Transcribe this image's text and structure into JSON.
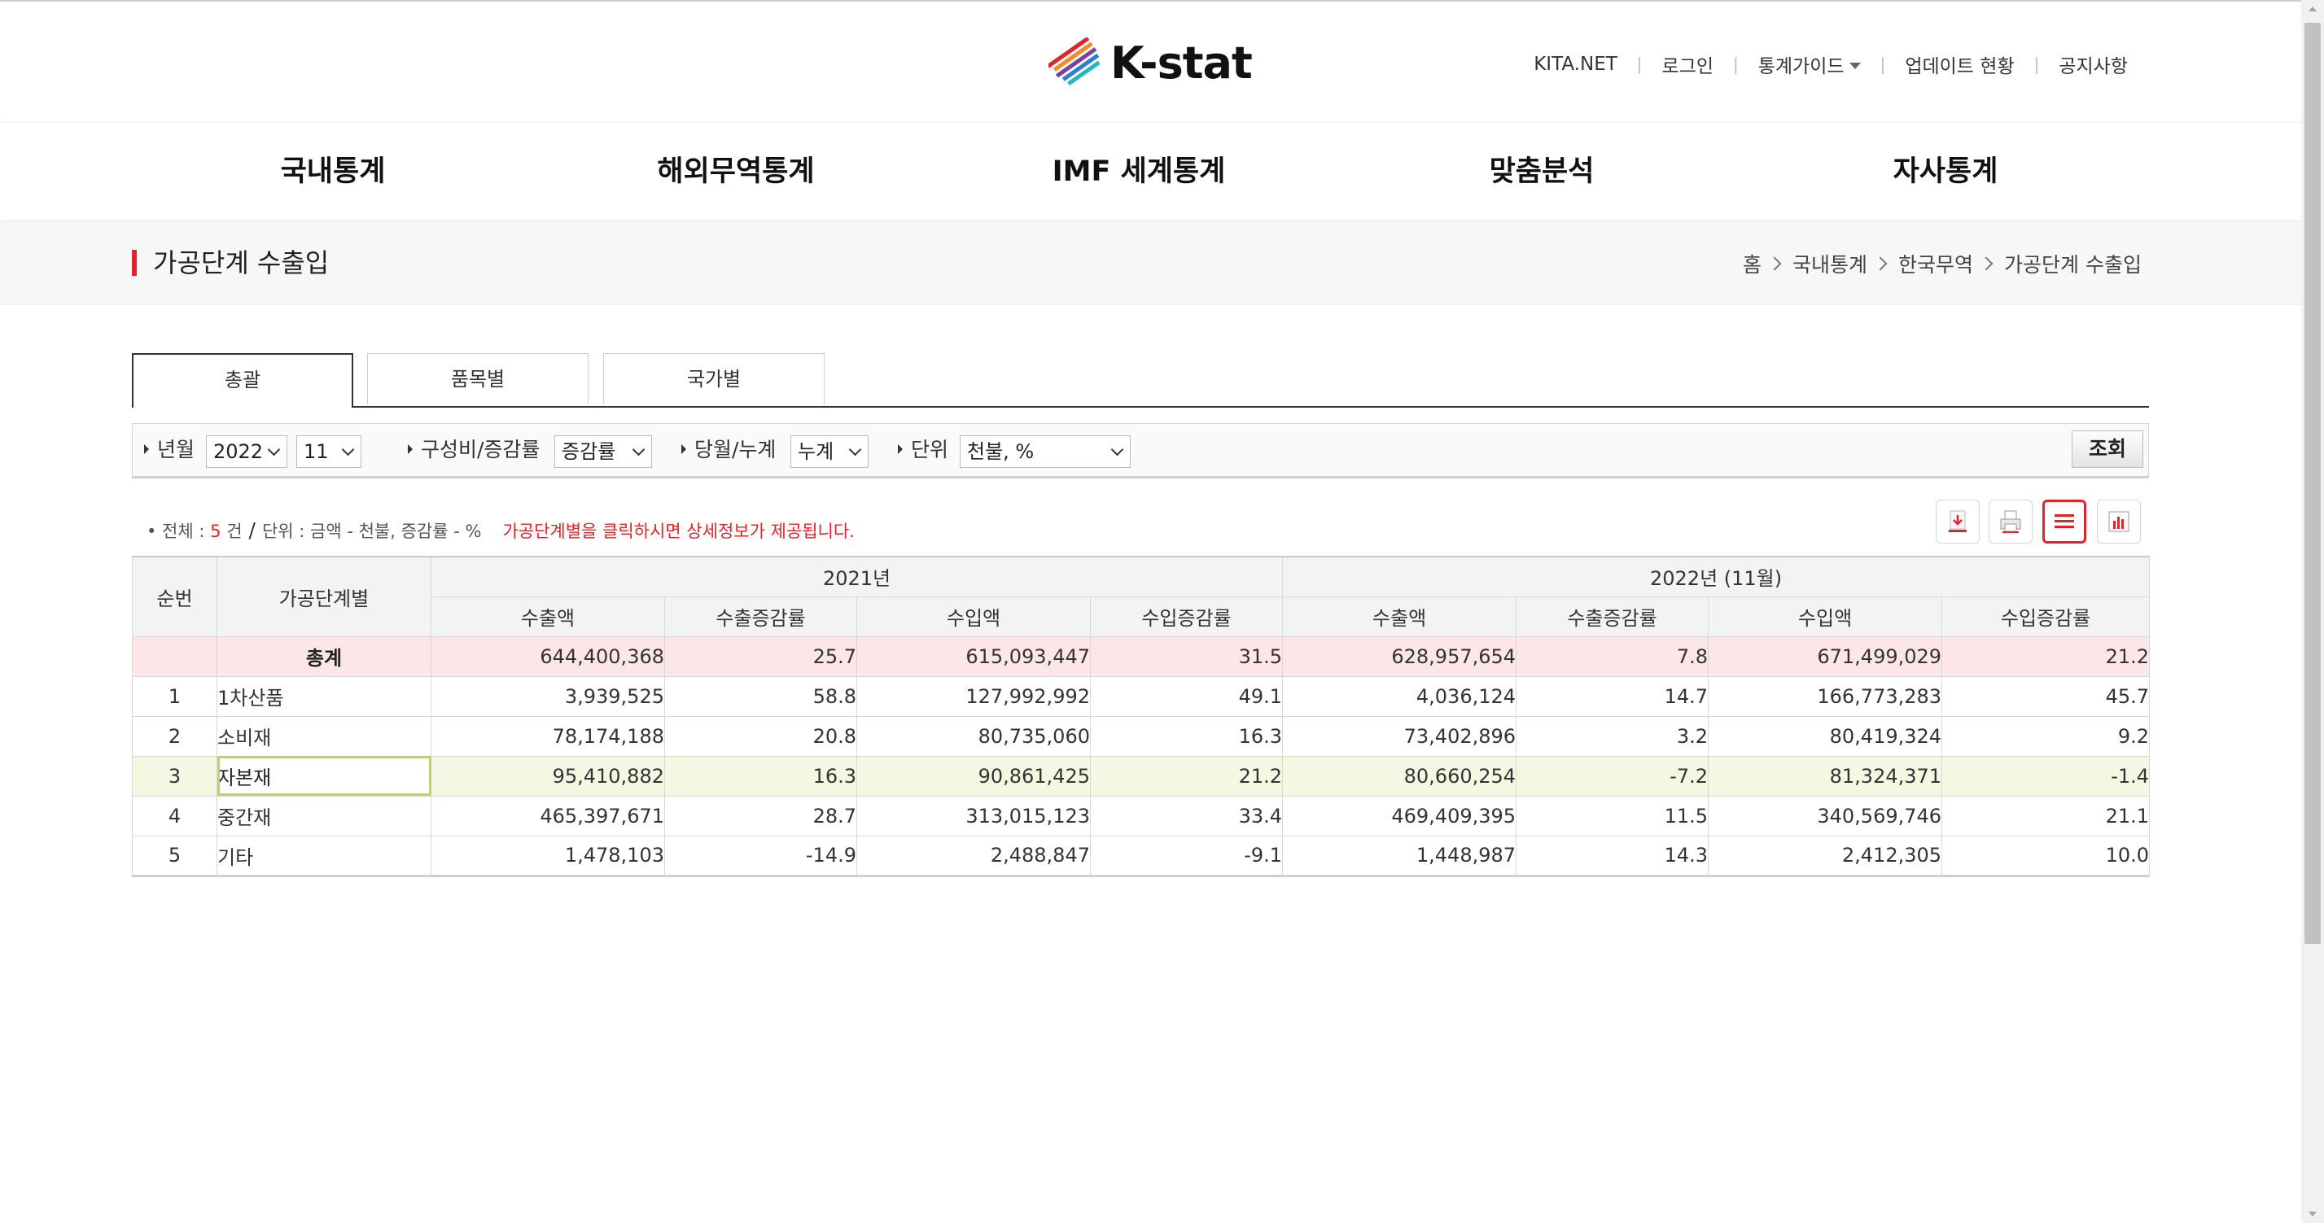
{
  "header": {
    "logo_text": "K-stat",
    "util_links": [
      "KITA.NET",
      "로그인",
      "통계가이드",
      "업데이트 현황",
      "공지사항"
    ]
  },
  "gnb": [
    "국내통계",
    "해외무역통계",
    "IMF 세계통계",
    "맞춤분석",
    "자사통계"
  ],
  "page": {
    "title": "가공단계 수출입",
    "breadcrumb": [
      "홈",
      "국내통계",
      "한국무역",
      "가공단계 수출입"
    ]
  },
  "tabs": [
    "총괄",
    "품목별",
    "국가별"
  ],
  "filters": {
    "year_month_label": "년월",
    "year_value": "2022",
    "month_value": "11",
    "composition_label": "구성비/증감률",
    "composition_value": "증감률",
    "period_label": "당월/누계",
    "period_value": "누계",
    "unit_label": "단위",
    "unit_value": "천불, %",
    "search_button": "조회"
  },
  "info": {
    "total_prefix": "• 전체 :",
    "total_count": "5",
    "total_suffix": "건",
    "unit_text": "단위 : 금액 - 천불, 증감률 - %",
    "notice": "가공단계별을 클릭하시면 상세정보가 제공됩니다."
  },
  "toolbar_icons": [
    "download-icon",
    "print-icon",
    "list-view-icon",
    "chart-view-icon"
  ],
  "table": {
    "col_no": "순번",
    "col_stage": "가공단계별",
    "period1": "2021년",
    "period2": "2022년 (11월)",
    "sub_headers": [
      "수출액",
      "수출증감률",
      "수입액",
      "수입증감률",
      "수출액",
      "수출증감률",
      "수입액",
      "수입증감률"
    ],
    "total": {
      "label": "총계",
      "values": [
        "644,400,368",
        "25.7",
        "615,093,447",
        "31.5",
        "628,957,654",
        "7.8",
        "671,499,029",
        "21.2"
      ]
    },
    "rows": [
      {
        "no": "1",
        "name": "1차산품",
        "values": [
          "3,939,525",
          "58.8",
          "127,992,992",
          "49.1",
          "4,036,124",
          "14.7",
          "166,773,283",
          "45.7"
        ]
      },
      {
        "no": "2",
        "name": "소비재",
        "values": [
          "78,174,188",
          "20.8",
          "80,735,060",
          "16.3",
          "73,402,896",
          "3.2",
          "80,419,324",
          "9.2"
        ]
      },
      {
        "no": "3",
        "name": "자본재",
        "values": [
          "95,410,882",
          "16.3",
          "90,861,425",
          "21.2",
          "80,660,254",
          "-7.2",
          "81,324,371",
          "-1.4"
        ]
      },
      {
        "no": "4",
        "name": "중간재",
        "values": [
          "465,397,671",
          "28.7",
          "313,015,123",
          "33.4",
          "469,409,395",
          "11.5",
          "340,569,746",
          "21.1"
        ]
      },
      {
        "no": "5",
        "name": "기타",
        "values": [
          "1,478,103",
          "-14.9",
          "2,488,847",
          "-9.1",
          "1,448,987",
          "14.3",
          "2,412,305",
          "10.0"
        ]
      }
    ]
  },
  "colors": {
    "accent": "#e2232a",
    "total_row_bg": "#fde6e7",
    "selected_row_bg": "#f4f8e3",
    "selected_cell_border": "#b9d75a",
    "link": "#1a1aa6"
  }
}
